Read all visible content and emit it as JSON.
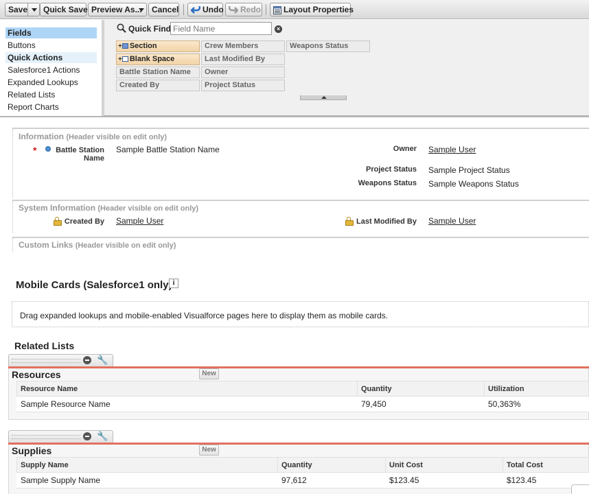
{
  "toolbar": {
    "save": "Save",
    "quick_save": "Quick Save",
    "preview_as": "Preview As...",
    "cancel": "Cancel",
    "undo": "Undo",
    "redo": "Redo",
    "layout_properties": "Layout Properties"
  },
  "palette": {
    "categories": [
      "Fields",
      "Buttons",
      "Quick Actions",
      "Salesforce1 Actions",
      "Expanded Lookups",
      "Related Lists",
      "Report Charts"
    ],
    "selected_category": "Fields",
    "quick_find_label": "Quick Find",
    "quick_find_placeholder": "Field Name",
    "items": [
      "Section",
      "Blank Space",
      "Battle Station Name",
      "Created By",
      "Crew Members",
      "Last Modified By",
      "Owner",
      "Project Status",
      "Weapons Status"
    ]
  },
  "layout": {
    "information": {
      "title": "Information",
      "subtitle": "(Header visible on edit only)",
      "fields": [
        {
          "label": "Battle Station Name",
          "value": "Sample Battle Station Name"
        },
        {
          "label": "Owner",
          "value": "Sample User"
        },
        {
          "label": "Project Status",
          "value": "Sample Project Status"
        },
        {
          "label": "Weapons Status",
          "value": "Sample Weapons Status"
        }
      ]
    },
    "system_information": {
      "title": "System Information",
      "subtitle": "(Header visible on edit only)",
      "fields": [
        {
          "label": "Created By",
          "value": "Sample User"
        },
        {
          "label": "Last Modified By",
          "value": "Sample User"
        }
      ]
    },
    "custom_links": {
      "title": "Custom Links",
      "subtitle": "(Header visible on edit only)"
    }
  },
  "mobile_cards": {
    "title": "Mobile Cards (Salesforce1 only)",
    "info_icon": "i",
    "drop_hint": "Drag expanded lookups and mobile-enabled Visualforce pages here to display them as mobile cards."
  },
  "related_lists": {
    "title": "Related Lists",
    "lists": [
      {
        "title": "Resources",
        "new_label": "New",
        "columns": [
          "Resource Name",
          "Quantity",
          "Utilization"
        ],
        "rows": [
          [
            "Sample Resource Name",
            "79,450",
            "50,363%"
          ]
        ]
      },
      {
        "title": "Supplies",
        "new_label": "New",
        "columns": [
          "Supply Name",
          "Quantity",
          "Unit Cost",
          "Total Cost"
        ],
        "rows": [
          [
            "Sample Supply Name",
            "97,612",
            "$123.45",
            "$123.45"
          ]
        ]
      }
    ]
  },
  "icons": {
    "undo": "undo-arrow-icon",
    "redo": "redo-arrow-icon",
    "layout_properties": "layout-properties-icon",
    "clear": "clear-icon",
    "lock": "lock-icon",
    "remove": "remove-icon",
    "wrench": "wrench-icon"
  },
  "colors": {
    "selected_category": "#aed5f6",
    "required": "#cc1e1e",
    "related_list_rule": "#e2705f"
  }
}
